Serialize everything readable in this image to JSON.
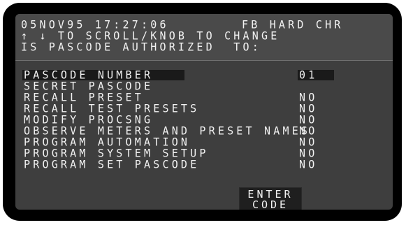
{
  "header": {
    "datetime": "05NOV95 17:27:06",
    "station": "FB HARD CHR",
    "instructions": "↑ ↓ TO SCROLL/KNOB TO CHANGE",
    "question": "IS PASCODE AUTHORIZED  TO:"
  },
  "menu": {
    "items": [
      {
        "label": "PASCODE NUMBER",
        "value": "01"
      },
      {
        "label": "SECRET PASCODE",
        "value": ""
      },
      {
        "label": "RECALL PRESET",
        "value": "NO"
      },
      {
        "label": "RECALL TEST PRESETS",
        "value": "NO"
      },
      {
        "label": "MODIFY PROCSNG",
        "value": "NO"
      },
      {
        "label": "OBSERVE METERS AND PRESET NAMES",
        "value": "NO"
      },
      {
        "label": "PROGRAM AUTOMATION",
        "value": "NO"
      },
      {
        "label": "PROGRAM SYSTEM SETUP",
        "value": "NO"
      },
      {
        "label": "PROGRAM SET PASCODE",
        "value": "NO"
      }
    ]
  },
  "enter_button": {
    "line1": "ENTER",
    "line2": "CODE"
  },
  "colors": {
    "bezel": "#000000",
    "screen": "#3e3e3e",
    "text": "#f2f2f2",
    "highlight": "#1a1a1a"
  }
}
